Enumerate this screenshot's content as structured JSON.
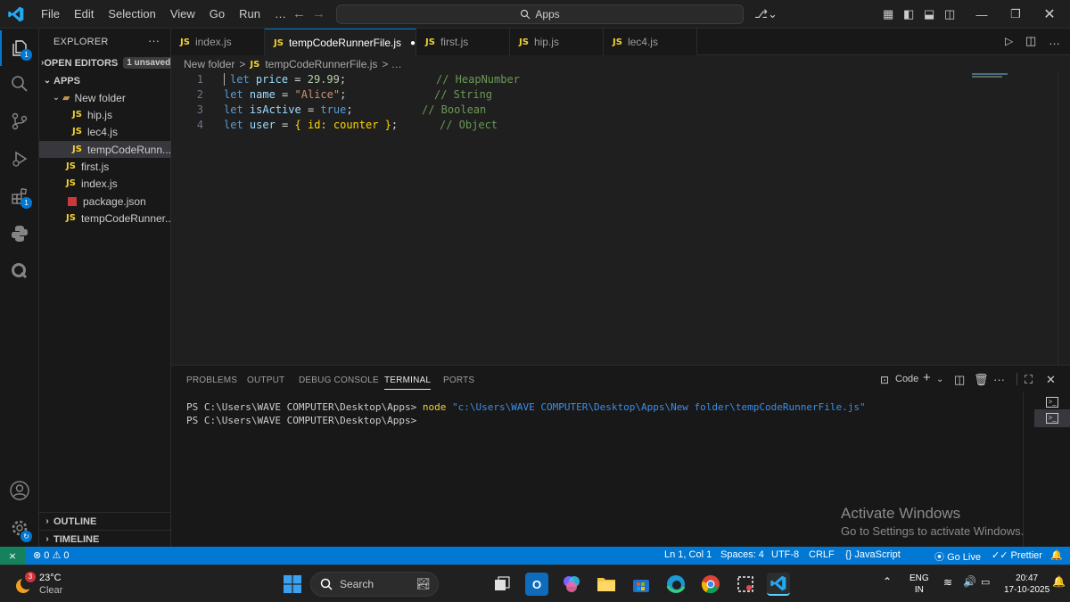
{
  "titlebar": {
    "menu": [
      "File",
      "Edit",
      "Selection",
      "View",
      "Go",
      "Run"
    ],
    "more": "…",
    "search_text": "Apps"
  },
  "activity": {
    "explorer_badge": "1",
    "extensions_badge": "1"
  },
  "sidebar": {
    "title": "EXPLORER",
    "more": "···",
    "open_editors": "OPEN EDITORS",
    "unsaved_badge": "1 unsaved",
    "apps": "APPS",
    "new_folder": "New folder",
    "folder_files": [
      "hip.js",
      "lec4.js",
      "tempCodeRunn..."
    ],
    "root_files": [
      "first.js",
      "index.js",
      "package.json",
      "tempCodeRunner..."
    ],
    "file_icon": "JS",
    "outline": "OUTLINE",
    "timeline": "TIMELINE"
  },
  "tabs": [
    {
      "label": "index.js",
      "active": false
    },
    {
      "label": "tempCodeRunnerFile.js",
      "active": true
    },
    {
      "label": "first.js",
      "active": false
    },
    {
      "label": "hip.js",
      "active": false
    },
    {
      "label": "lec4.js",
      "active": false
    }
  ],
  "breadcrumb": {
    "folder": "New folder",
    "sep": ">",
    "file": "tempCodeRunnerFile.js",
    "tail": "> …"
  },
  "editor": {
    "line_numbers": [
      "1",
      "2",
      "3",
      "4"
    ],
    "lines": [
      {
        "kw": "let",
        "name": "price",
        "op": " = ",
        "value": "29.99",
        "value_type": "num",
        "end": ";",
        "comment": "// HeapNumber"
      },
      {
        "kw": "let",
        "name": "name",
        "op": " = ",
        "value": "\"Alice\"",
        "value_type": "str",
        "end": ";",
        "comment": "// String"
      },
      {
        "kw": "let",
        "name": "isActive",
        "op": " = ",
        "value": "true",
        "value_type": "kw",
        "end": ";",
        "comment": "// Boolean"
      },
      {
        "kw": "let",
        "name": "user",
        "op": " = ",
        "value": "{ id: counter }",
        "value_type": "obj",
        "end": ";",
        "comment": "// Object"
      }
    ]
  },
  "panel": {
    "tabs": [
      "PROBLEMS",
      "OUTPUT",
      "DEBUG CONSOLE",
      "TERMINAL",
      "PORTS"
    ],
    "active_tab": "TERMINAL",
    "terminal_name": "Code",
    "prompt": "PS C:\\Users\\WAVE COMPUTER\\Desktop\\Apps>",
    "command": "node",
    "arg": "\"c:\\Users\\WAVE COMPUTER\\Desktop\\Apps\\New folder\\tempCodeRunnerFile.js\"",
    "prompt2": "PS C:\\Users\\WAVE COMPUTER\\Desktop\\Apps>",
    "watermark_title": "Activate Windows",
    "watermark_sub": "Go to Settings to activate Windows."
  },
  "statusbar": {
    "errors": "0",
    "warnings": "0",
    "position": "Ln 1, Col 1",
    "spaces": "Spaces: 4",
    "encoding": "UTF-8",
    "eol": "CRLF",
    "language": "JavaScript",
    "golive": "Go Live",
    "prettier": "Prettier"
  },
  "taskbar": {
    "weather_temp": "23°C",
    "weather_desc": "Clear",
    "weather_badge": "3",
    "search": "Search",
    "lang1": "ENG",
    "lang2": "IN",
    "time": "20:47",
    "date": "17-10-2025"
  },
  "colors": {
    "accent": "#0078d4",
    "js_yellow": "#f1d232",
    "keyword": "#569cd6",
    "comment": "#6a9955"
  }
}
